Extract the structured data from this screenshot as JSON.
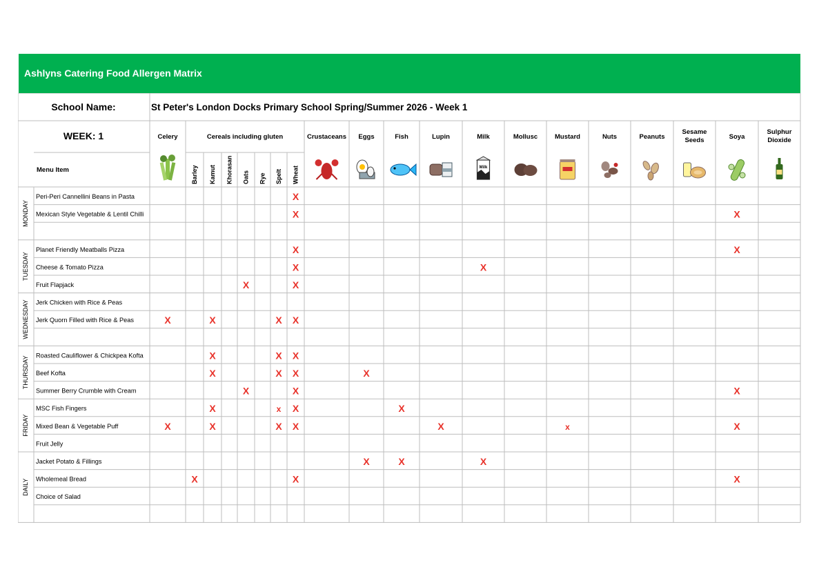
{
  "title": "Ashlyns Catering Food Allergen Matrix",
  "school_label": "School Name:",
  "school_name": "St Peter's London Docks Primary School Spring/Summer 2026 - Week 1",
  "week_label": "WEEK: 1",
  "menu_item_label": "Menu Item",
  "cereals_group_label": "Cereals including gluten",
  "mark_color": "#e8322a",
  "header_fill": "#00b050",
  "columns": [
    {
      "key": "celery",
      "label": "Celery",
      "icon": "celery-icon"
    },
    {
      "key": "barley",
      "label": "Barley",
      "sub": true
    },
    {
      "key": "kamut",
      "label": "Kamut",
      "sub": true
    },
    {
      "key": "khorasan",
      "label": "Khorasan",
      "sub": true
    },
    {
      "key": "oats",
      "label": "Oats",
      "sub": true
    },
    {
      "key": "rye",
      "label": "Rye",
      "sub": true
    },
    {
      "key": "spelt",
      "label": "Spelt",
      "sub": true
    },
    {
      "key": "wheat",
      "label": "Wheat",
      "sub": true
    },
    {
      "key": "crustaceans",
      "label": "Crustaceans",
      "icon": "crustacean-icon"
    },
    {
      "key": "eggs",
      "label": "Eggs",
      "icon": "egg-icon"
    },
    {
      "key": "fish",
      "label": "Fish",
      "icon": "fish-icon"
    },
    {
      "key": "lupin",
      "label": "Lupin",
      "icon": "lupin-bread-icon"
    },
    {
      "key": "milk",
      "label": "Milk",
      "icon": "milk-carton-icon",
      "icon_text": "Milk"
    },
    {
      "key": "mollusc",
      "label": "Mollusc",
      "icon": "mollusc-icon"
    },
    {
      "key": "mustard",
      "label": "Mustard",
      "icon": "mustard-jar-icon"
    },
    {
      "key": "nuts",
      "label": "Nuts",
      "icon": "nuts-icon"
    },
    {
      "key": "peanuts",
      "label": "Peanuts",
      "icon": "peanut-icon"
    },
    {
      "key": "sesame",
      "label": "Sesame Seeds",
      "label_lines": [
        "Sesame",
        "Seeds"
      ],
      "icon": "sesame-icon"
    },
    {
      "key": "soya",
      "label": "Soya",
      "icon": "soya-bean-icon"
    },
    {
      "key": "sulphur",
      "label": "Sulphur Dioxide",
      "label_lines": [
        "Sulphur",
        "Dioxide"
      ],
      "icon": "wine-bottle-icon"
    }
  ],
  "days": [
    {
      "day": "MONDAY",
      "items": [
        {
          "name": "Peri-Peri Cannellini Beans in Pasta",
          "marks": {
            "wheat": "X"
          }
        },
        {
          "name": "Mexican Style Vegetable & Lentil Chilli",
          "marks": {
            "wheat": "X",
            "soya": "X"
          }
        },
        {
          "name": "",
          "marks": {}
        }
      ]
    },
    {
      "day": "TUESDAY",
      "items": [
        {
          "name": "Planet Friendly Meatballs Pizza",
          "marks": {
            "wheat": "X",
            "soya": "X"
          }
        },
        {
          "name": "Cheese & Tomato Pizza",
          "marks": {
            "wheat": "X",
            "milk": "X"
          }
        },
        {
          "name": "Fruit Flapjack",
          "marks": {
            "oats": "X",
            "wheat": "X"
          }
        }
      ]
    },
    {
      "day": "WEDNESDAY",
      "items": [
        {
          "name": "Jerk Chicken with Rice & Peas",
          "marks": {}
        },
        {
          "name": "Jerk Quorn Filled with Rice & Peas",
          "marks": {
            "celery": "X",
            "kamut": "X",
            "spelt": "X",
            "wheat": "X"
          }
        },
        {
          "name": "",
          "marks": {}
        }
      ]
    },
    {
      "day": "THURSDAY",
      "items": [
        {
          "name": "Roasted Cauliflower & Chickpea Kofta",
          "marks": {
            "kamut": "X",
            "spelt": "X",
            "wheat": "X"
          }
        },
        {
          "name": "Beef Kofta",
          "marks": {
            "kamut": "X",
            "spelt": "X",
            "wheat": "X",
            "eggs": "X"
          }
        },
        {
          "name": "Summer Berry Crumble with Cream",
          "marks": {
            "oats": "X",
            "wheat": "X",
            "soya": "X"
          }
        }
      ]
    },
    {
      "day": "FRIDAY",
      "items": [
        {
          "name": "MSC Fish Fingers",
          "marks": {
            "kamut": "X",
            "spelt": "x",
            "wheat": "X",
            "fish": "X"
          }
        },
        {
          "name": "Mixed Bean & Vegetable Puff",
          "marks": {
            "celery": "X",
            "kamut": "X",
            "spelt": "X",
            "wheat": "X",
            "lupin": "X",
            "mustard": "x",
            "soya": "X"
          }
        },
        {
          "name": "Fruit Jelly",
          "marks": {}
        }
      ]
    },
    {
      "day": "DAILY",
      "items": [
        {
          "name": "Jacket Potato & Fillings",
          "marks": {
            "eggs": "X",
            "fish": "X",
            "milk": "X"
          }
        },
        {
          "name": "Wholemeal Bread",
          "marks": {
            "barley": "X",
            "wheat": "X",
            "soya": "X"
          }
        },
        {
          "name": "Choice of Salad",
          "marks": {}
        },
        {
          "name": "",
          "marks": {}
        }
      ]
    }
  ]
}
